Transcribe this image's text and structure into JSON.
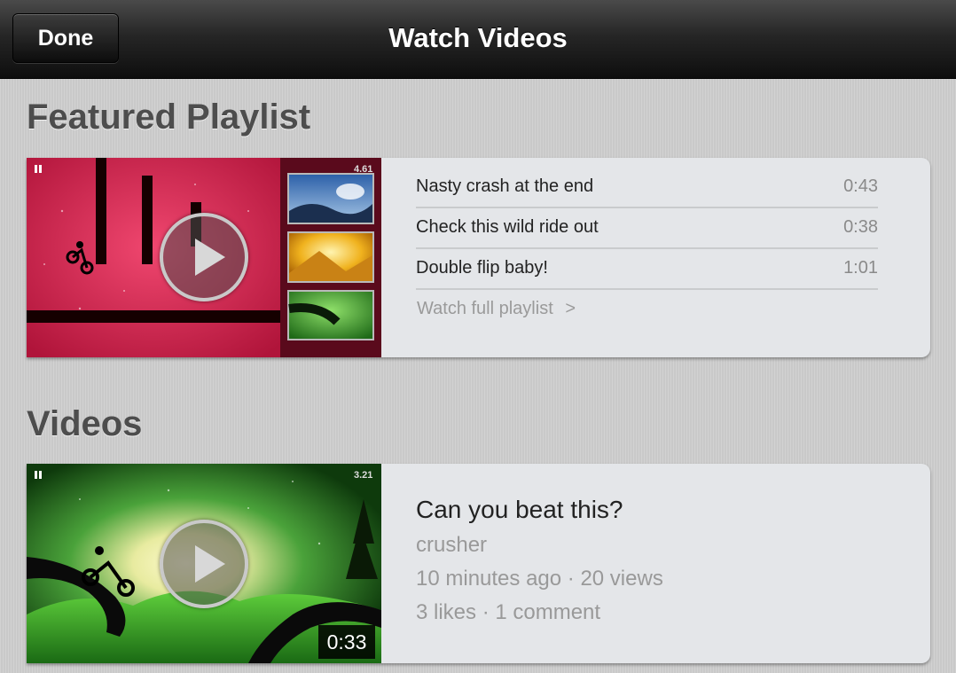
{
  "navbar": {
    "done_label": "Done",
    "title": "Watch Videos"
  },
  "featured": {
    "heading": "Featured Playlist",
    "thumbnail": {
      "score": "4.61",
      "icons": [
        "pause-icon",
        "play-icon"
      ]
    },
    "items": [
      {
        "title": "Nasty crash at the end",
        "duration": "0:43"
      },
      {
        "title": "Check this wild ride out",
        "duration": "0:38"
      },
      {
        "title": "Double flip baby!",
        "duration": "1:01"
      }
    ],
    "more_label": "Watch full playlist",
    "more_chevron": ">"
  },
  "videos": {
    "heading": "Videos",
    "items": [
      {
        "title": "Can you beat this?",
        "author": "crusher",
        "time_views": "10 minutes ago · 20 views",
        "likes_comments": "3 likes · 1 comment",
        "duration": "0:33",
        "score": "3.21"
      }
    ]
  },
  "colors": {
    "accent_red": "#d5204f",
    "accent_green": "#2e8a22",
    "background": "#cfcfcf",
    "card": "#e4e6e9"
  }
}
